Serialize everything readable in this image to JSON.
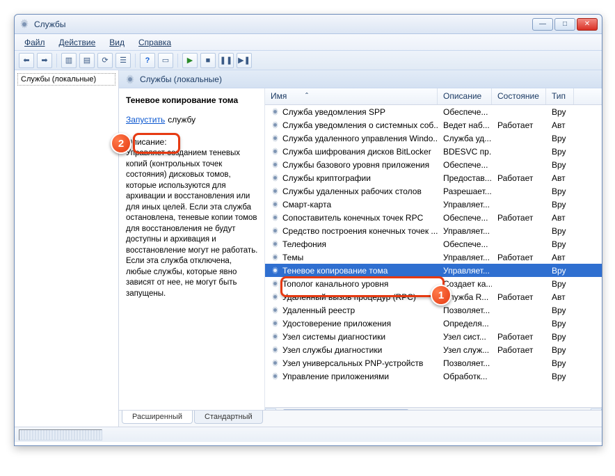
{
  "window": {
    "title": "Службы"
  },
  "menu": {
    "file": "Файл",
    "action": "Действие",
    "view": "Вид",
    "help": "Справка"
  },
  "tree": {
    "root": "Службы (локальные)"
  },
  "pane": {
    "heading": "Службы (локальные)"
  },
  "detail": {
    "service_name": "Теневое копирование тома",
    "action_link": "Запустить",
    "action_suffix": "службу",
    "desc_heading": "Описание:",
    "desc_text": "Управляет созданием теневых копий (контрольных точек состояния) дисковых томов, которые используются для архивации и восстановления или для иных целей. Если эта служба остановлена, теневые копии томов для восстановления не будут доступны и архивация и восстановление могут не работать. Если эта служба отключена, любые службы, которые явно зависят от нее, не могут быть запущены."
  },
  "columns": {
    "name": "Имя",
    "desc": "Описание",
    "state": "Состояние",
    "type": "Тип"
  },
  "tabs": {
    "extended": "Расширенный",
    "standard": "Стандартный"
  },
  "callouts": {
    "one": "1",
    "two": "2"
  },
  "services": [
    {
      "name": "Служба уведомления SPP",
      "desc": "Обеспече...",
      "state": "",
      "type": "Вру"
    },
    {
      "name": "Служба уведомления о системных соб...",
      "desc": "Ведет наб...",
      "state": "Работает",
      "type": "Авт"
    },
    {
      "name": "Служба удаленного управления Windo...",
      "desc": "Служба уд...",
      "state": "",
      "type": "Вру"
    },
    {
      "name": "Служба шифрования дисков BitLocker",
      "desc": "BDESVC пр...",
      "state": "",
      "type": "Вру"
    },
    {
      "name": "Службы базового уровня приложения",
      "desc": "Обеспече...",
      "state": "",
      "type": "Вру"
    },
    {
      "name": "Службы криптографии",
      "desc": "Предостав...",
      "state": "Работает",
      "type": "Авт"
    },
    {
      "name": "Службы удаленных рабочих столов",
      "desc": "Разрешает...",
      "state": "",
      "type": "Вру"
    },
    {
      "name": "Смарт-карта",
      "desc": "Управляет...",
      "state": "",
      "type": "Вру"
    },
    {
      "name": "Сопоставитель конечных точек RPC",
      "desc": "Обеспече...",
      "state": "Работает",
      "type": "Авт"
    },
    {
      "name": "Средство построения конечных точек ...",
      "desc": "Управляет...",
      "state": "",
      "type": "Вру"
    },
    {
      "name": "Телефония",
      "desc": "Обеспече...",
      "state": "",
      "type": "Вру"
    },
    {
      "name": "Темы",
      "desc": "Управляет...",
      "state": "Работает",
      "type": "Авт"
    },
    {
      "name": "Теневое копирование тома",
      "desc": "Управляет...",
      "state": "",
      "type": "Вру",
      "selected": true
    },
    {
      "name": "Тополог канального уровня",
      "desc": "Создает ка...",
      "state": "",
      "type": "Вру"
    },
    {
      "name": "Удаленный вызов процедур (RPC)",
      "desc": "Служба R...",
      "state": "Работает",
      "type": "Авт"
    },
    {
      "name": "Удаленный реестр",
      "desc": "Позволяет...",
      "state": "",
      "type": "Вру"
    },
    {
      "name": "Удостоверение приложения",
      "desc": "Определя...",
      "state": "",
      "type": "Вру"
    },
    {
      "name": "Узел системы диагностики",
      "desc": "Узел сист...",
      "state": "Работает",
      "type": "Вру"
    },
    {
      "name": "Узел службы диагностики",
      "desc": "Узел служ...",
      "state": "Работает",
      "type": "Вру"
    },
    {
      "name": "Узел универсальных PNP-устройств",
      "desc": "Позволяет...",
      "state": "",
      "type": "Вру"
    },
    {
      "name": "Управление приложениями",
      "desc": "Обработк...",
      "state": "",
      "type": "Вру"
    }
  ]
}
